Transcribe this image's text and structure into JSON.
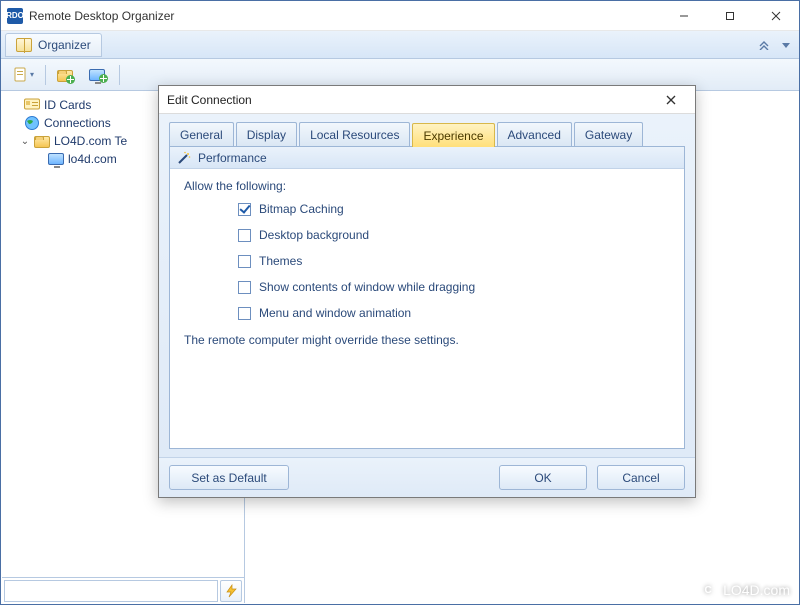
{
  "app": {
    "icon_text": "RDO",
    "title": "Remote Desktop Organizer"
  },
  "menubar": {
    "organizer": "Organizer"
  },
  "tree": {
    "id_cards": "ID Cards",
    "connections": "Connections",
    "folder1": "LO4D.com Te",
    "item1": "lo4d.com"
  },
  "dialog": {
    "title": "Edit Connection",
    "tabs": {
      "general": "General",
      "display": "Display",
      "local_resources": "Local Resources",
      "experience": "Experience",
      "advanced": "Advanced",
      "gateway": "Gateway"
    },
    "section": "Performance",
    "intro": "Allow the following:",
    "options": {
      "bitmap_caching": {
        "label": "Bitmap Caching",
        "checked": true
      },
      "desktop_background": {
        "label": "Desktop background",
        "checked": false
      },
      "themes": {
        "label": "Themes",
        "checked": false
      },
      "show_contents": {
        "label": "Show contents of window while dragging",
        "checked": false
      },
      "menu_animation": {
        "label": "Menu and window animation",
        "checked": false
      }
    },
    "note": "The remote computer might override these settings.",
    "buttons": {
      "set_default": "Set as Default",
      "ok": "OK",
      "cancel": "Cancel"
    }
  },
  "watermark": "LO4D.com"
}
